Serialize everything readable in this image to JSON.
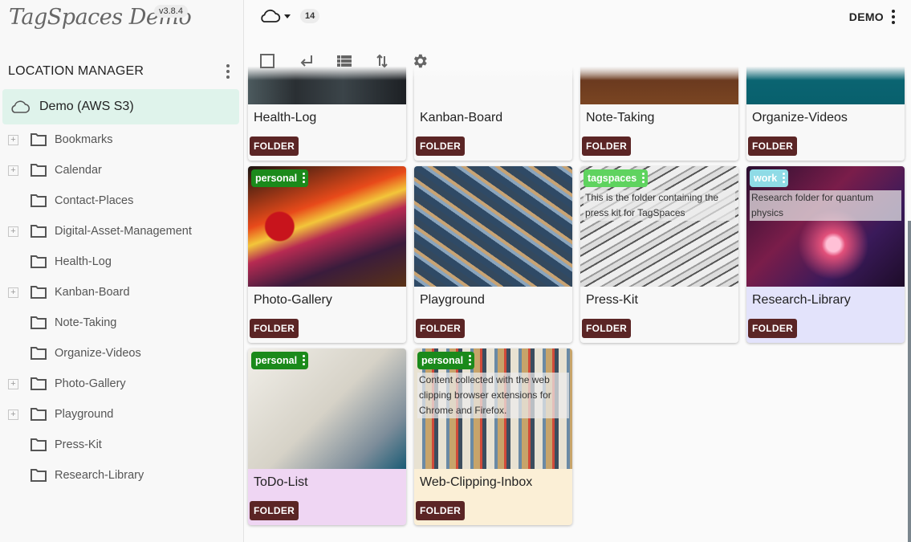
{
  "app": {
    "logo": "TagSpaces Demo",
    "version": "v3.8.4"
  },
  "sidebar": {
    "title": "LOCATION MANAGER",
    "location": {
      "name": "Demo (AWS S3)",
      "icon": "cloud-icon",
      "highlight_color": "#dff3eb"
    },
    "folders": [
      {
        "label": "Bookmarks",
        "expandable": true
      },
      {
        "label": "Calendar",
        "expandable": true
      },
      {
        "label": "Contact-Places",
        "expandable": false
      },
      {
        "label": "Digital-Asset-Management",
        "expandable": true
      },
      {
        "label": "Health-Log",
        "expandable": false
      },
      {
        "label": "Kanban-Board",
        "expandable": true
      },
      {
        "label": "Note-Taking",
        "expandable": false
      },
      {
        "label": "Organize-Videos",
        "expandable": false
      },
      {
        "label": "Photo-Gallery",
        "expandable": true
      },
      {
        "label": "Playground",
        "expandable": true
      },
      {
        "label": "Press-Kit",
        "expandable": false
      },
      {
        "label": "Research-Library",
        "expandable": false
      }
    ],
    "expander_symbol": "+"
  },
  "topbar": {
    "location_icon": "cloud-icon",
    "entry_count": "14",
    "user_label": "DEMO"
  },
  "toolbar": {
    "tools": [
      {
        "name": "select-all",
        "icon": "checkbox-outline-icon"
      },
      {
        "name": "parent-folder",
        "icon": "subdirectory-arrow-icon"
      },
      {
        "name": "toggle-view",
        "icon": "view-list-icon"
      },
      {
        "name": "sort",
        "icon": "sort-arrows-icon"
      },
      {
        "name": "settings",
        "icon": "gear-icon"
      }
    ]
  },
  "grid": {
    "folder_badge_color": "#5b2525",
    "cards": [
      {
        "title": "Health-Log",
        "badge": "FOLDER",
        "bg": "#f8f8f8",
        "tag": null,
        "description": null
      },
      {
        "title": "Kanban-Board",
        "badge": "FOLDER",
        "bg": "#f8f8f8",
        "tag": null,
        "description": null
      },
      {
        "title": "Note-Taking",
        "badge": "FOLDER",
        "bg": "#f8f8f8",
        "tag": null,
        "description": null
      },
      {
        "title": "Organize-Videos",
        "badge": "FOLDER",
        "bg": "#f8f8f8",
        "tag": null,
        "description": null
      },
      {
        "title": "Photo-Gallery",
        "badge": "FOLDER",
        "bg": "#f8f8f8",
        "tag": {
          "label": "personal",
          "color": "#1b8a1b"
        },
        "description": null
      },
      {
        "title": "Playground",
        "badge": "FOLDER",
        "bg": "#f8f8f8",
        "tag": null,
        "description": null
      },
      {
        "title": "Press-Kit",
        "badge": "FOLDER",
        "bg": "#f8f8f8",
        "tag": {
          "label": "tagspaces",
          "color": "#5fd35f"
        },
        "description": "This is the folder containing the press kit for TagSpaces"
      },
      {
        "title": "Research-Library",
        "badge": "FOLDER",
        "bg": "#e3e3fb",
        "tag": {
          "label": "work",
          "color": "#8fdbe6"
        },
        "description": "Research folder for quantum physics"
      },
      {
        "title": "ToDo-List",
        "badge": "FOLDER",
        "bg": "#efd6f3",
        "tag": {
          "label": "personal",
          "color": "#1b8a1b"
        },
        "description": null
      },
      {
        "title": "Web-Clipping-Inbox",
        "badge": "FOLDER",
        "bg": "#fbefd6",
        "tag": {
          "label": "personal",
          "color": "#1b8a1b"
        },
        "description": "Content collected with the web clipping browser extensions for Chrome and Firefox."
      }
    ]
  }
}
